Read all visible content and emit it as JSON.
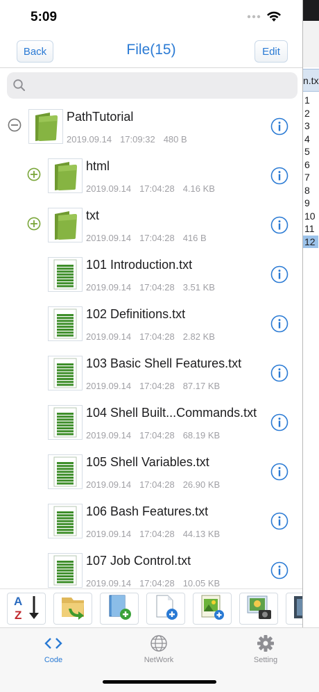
{
  "status": {
    "time": "5:09"
  },
  "nav": {
    "back_label": "Back",
    "title": "File(15)",
    "edit_label": "Edit"
  },
  "search": {
    "placeholder": ""
  },
  "files": [
    {
      "name": "PathTutorial",
      "type": "folder",
      "level": 0,
      "expander": "minus",
      "date": "2019.09.14",
      "time": "17:09:32",
      "size": "480 B"
    },
    {
      "name": "html",
      "type": "folder",
      "level": 1,
      "expander": "plus",
      "date": "2019.09.14",
      "time": "17:04:28",
      "size": "4.16 KB"
    },
    {
      "name": "txt",
      "type": "folder",
      "level": 1,
      "expander": "plus",
      "date": "2019.09.14",
      "time": "17:04:28",
      "size": "416 B"
    },
    {
      "name": "101 Introduction.txt",
      "type": "file",
      "level": 1,
      "date": "2019.09.14",
      "time": "17:04:28",
      "size": "3.51 KB"
    },
    {
      "name": "102 Definitions.txt",
      "type": "file",
      "level": 1,
      "date": "2019.09.14",
      "time": "17:04:28",
      "size": "2.82 KB"
    },
    {
      "name": "103 Basic Shell Features.txt",
      "type": "file",
      "level": 1,
      "date": "2019.09.14",
      "time": "17:04:28",
      "size": "87.17 KB"
    },
    {
      "name": "104 Shell Built...Commands.txt",
      "type": "file",
      "level": 1,
      "date": "2019.09.14",
      "time": "17:04:28",
      "size": "68.19 KB"
    },
    {
      "name": "105 Shell Variables.txt",
      "type": "file",
      "level": 1,
      "date": "2019.09.14",
      "time": "17:04:28",
      "size": "26.90 KB"
    },
    {
      "name": "106 Bash Features.txt",
      "type": "file",
      "level": 1,
      "date": "2019.09.14",
      "time": "17:04:28",
      "size": "44.13 KB"
    },
    {
      "name": "107 Job Control.txt",
      "type": "file",
      "level": 1,
      "date": "2019.09.14",
      "time": "17:04:28",
      "size": "10.05 KB"
    }
  ],
  "toolbar": {
    "tools": [
      {
        "name": "sort-az-tool",
        "icon": "sort-az-icon"
      },
      {
        "name": "move-folder-tool",
        "icon": "folder-arrow-icon"
      },
      {
        "name": "new-file-blue-tool",
        "icon": "new-file-icon"
      },
      {
        "name": "new-blank-file-tool",
        "icon": "new-document-icon"
      },
      {
        "name": "new-image-tool",
        "icon": "new-image-icon"
      },
      {
        "name": "photo-import-tool",
        "icon": "photo-camera-icon"
      },
      {
        "name": "more-tool",
        "icon": "image-icon"
      }
    ]
  },
  "tabs": [
    {
      "label": "Code",
      "icon": "code-icon",
      "active": true
    },
    {
      "label": "NetWork",
      "icon": "globe-icon",
      "active": false
    },
    {
      "label": "Setting",
      "icon": "gear-icon",
      "active": false
    }
  ],
  "side_panel": {
    "file_name": "n.tx",
    "line_numbers": [
      "1",
      "2",
      "3",
      "4",
      "5",
      "6",
      "7",
      "8",
      "9",
      "10",
      "11",
      "12"
    ],
    "highlighted_line": "12"
  },
  "colors": {
    "accent": "#2a7ad4",
    "folder_green": "#7aa63a",
    "meta_grey": "#a0a0a5"
  }
}
